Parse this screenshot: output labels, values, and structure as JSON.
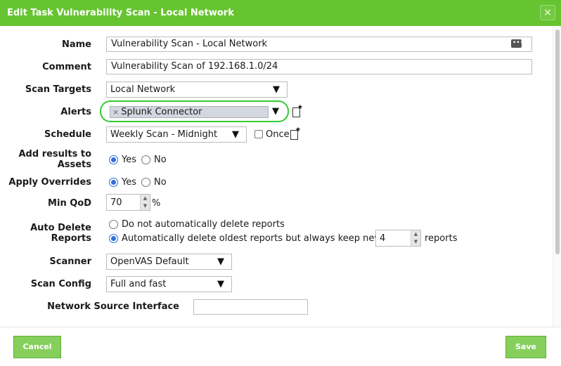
{
  "dialog": {
    "title": "Edit Task Vulnerability Scan - Local Network",
    "close_glyph": "×"
  },
  "fields": {
    "name": {
      "label": "Name",
      "value": "Vulnerability Scan - Local Network",
      "icon": "more-icon"
    },
    "comment": {
      "label": "Comment",
      "value": "Vulnerability Scan of 192.168.1.0/24"
    },
    "scan_targets": {
      "label": "Scan Targets",
      "value": "Local Network"
    },
    "alerts": {
      "label": "Alerts",
      "tag_remove": "×",
      "tag": "Splunk Connector"
    },
    "schedule": {
      "label": "Schedule",
      "value": "Weekly Scan - Midnight",
      "once_label": "Once",
      "once_checked": false
    },
    "add_results": {
      "label_line1": "Add results to",
      "label_line2": "Assets",
      "yes": "Yes",
      "no": "No",
      "selected": "Yes"
    },
    "apply_overrides": {
      "label": "Apply Overrides",
      "yes": "Yes",
      "no": "No",
      "selected": "Yes"
    },
    "min_qod": {
      "label": "Min QoD",
      "value": "70",
      "unit": "%"
    },
    "auto_delete": {
      "label_line1": "Auto Delete",
      "label_line2": "Reports",
      "option1": "Do not automatically delete reports",
      "option2": "Automatically delete oldest reports but always keep newest",
      "keep_value": "4",
      "suffix": "reports",
      "selected": "option2"
    },
    "scanner": {
      "label": "Scanner",
      "value": "OpenVAS Default"
    },
    "scan_config": {
      "label": "Scan Config",
      "value": "Full and fast"
    },
    "network_source_interface": {
      "label": "Network Source Interface",
      "value": ""
    }
  },
  "buttons": {
    "cancel": "Cancel",
    "save": "Save"
  },
  "colors": {
    "header": "#66c430",
    "button": "#87cf5d",
    "highlight": "#33cc33",
    "radio_selected": "#2f6fdc"
  }
}
